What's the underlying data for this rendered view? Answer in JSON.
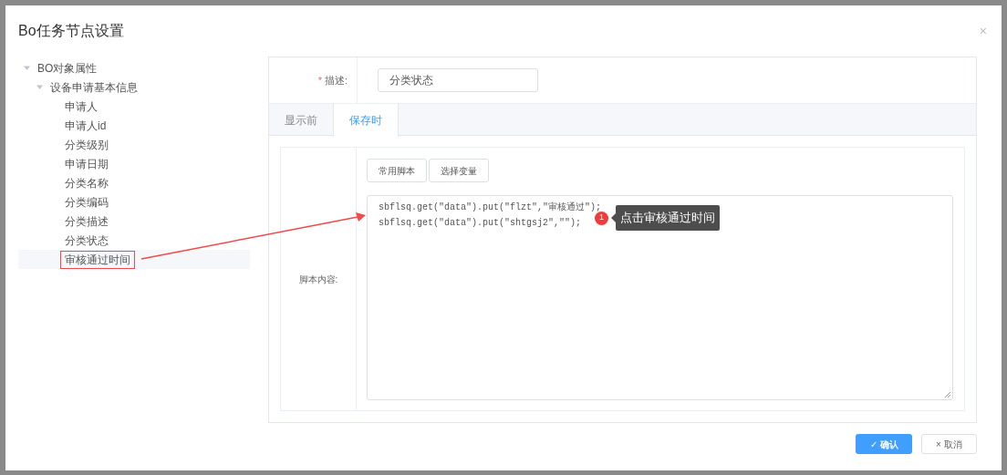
{
  "dialog": {
    "title": "Bo任务节点设置",
    "close": "×"
  },
  "tree": [
    {
      "label": "BO对象属性",
      "expanded": true,
      "children": [
        {
          "label": "设备申请基本信息",
          "expanded": true,
          "children": [
            {
              "label": "申请人",
              "selected": false,
              "framed": false
            },
            {
              "label": "申请人id",
              "selected": false,
              "framed": false
            },
            {
              "label": "分类级别",
              "selected": false,
              "framed": false
            },
            {
              "label": "申请日期",
              "selected": false,
              "framed": false
            },
            {
              "label": "分类名称",
              "selected": false,
              "framed": false
            },
            {
              "label": "分类编码",
              "selected": false,
              "framed": false
            },
            {
              "label": "分类描述",
              "selected": false,
              "framed": false
            },
            {
              "label": "分类状态",
              "selected": false,
              "framed": false
            },
            {
              "label": "审核通过时间",
              "selected": true,
              "framed": true
            }
          ]
        }
      ]
    }
  ],
  "form": {
    "required_mark": "*",
    "label": "描述:",
    "value": "分类状态"
  },
  "tabs": [
    {
      "label": "显示前",
      "selected": false
    },
    {
      "label": "保存时",
      "selected": true
    }
  ],
  "script": {
    "label": "脚本内容:",
    "buttons": [
      "常用脚本",
      "选择变量"
    ],
    "lines": [
      "sbflsq.get(\"data\").put(\"flzt\",\"审核通过\");",
      "sbflsq.get(\"data\").put(\"shtgsj2\",\"\");"
    ]
  },
  "annotation": {
    "number": "1",
    "text": "点击审核通过时间"
  },
  "footer": {
    "confirm": {
      "icon": "✓",
      "label": "确认"
    },
    "cancel": {
      "icon": "×",
      "label": "取消"
    }
  }
}
